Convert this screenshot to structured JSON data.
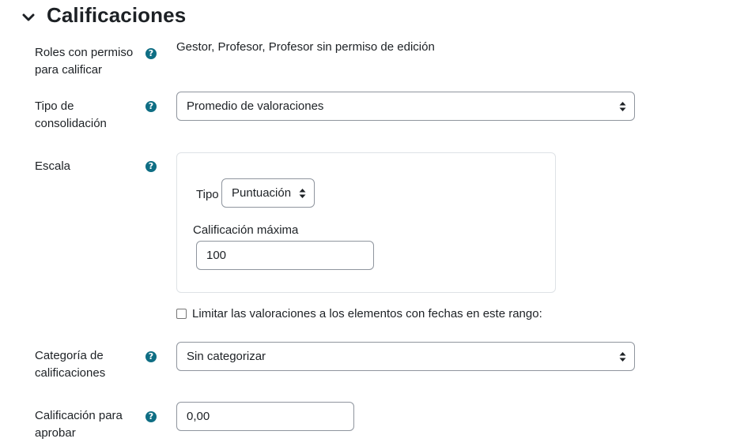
{
  "section": {
    "title": "Calificaciones",
    "toggle_icon": "chevron-down-icon"
  },
  "fields": {
    "roles": {
      "label": "Roles con permiso para calificar",
      "value": "Gestor, Profesor, Profesor sin permiso de edición"
    },
    "aggregate": {
      "label": "Tipo de consolidación",
      "value": "Promedio de valoraciones"
    },
    "scale": {
      "label": "Escala",
      "type_label": "Tipo",
      "type_value": "Puntuación",
      "max_label": "Calificación máxima",
      "max_value": "100"
    },
    "limit_dates": {
      "label": "Limitar las valoraciones a los elementos con fechas en este rango:",
      "checked": false
    },
    "category": {
      "label": "Categoría de calificaciones",
      "value": "Sin categorizar"
    },
    "pass": {
      "label": "Calificación para aprobar",
      "value": "0,00"
    }
  },
  "help_glyph": "?",
  "colors": {
    "help_icon": "#0f6e84",
    "text": "#1d2125",
    "border": "#8f959e"
  }
}
